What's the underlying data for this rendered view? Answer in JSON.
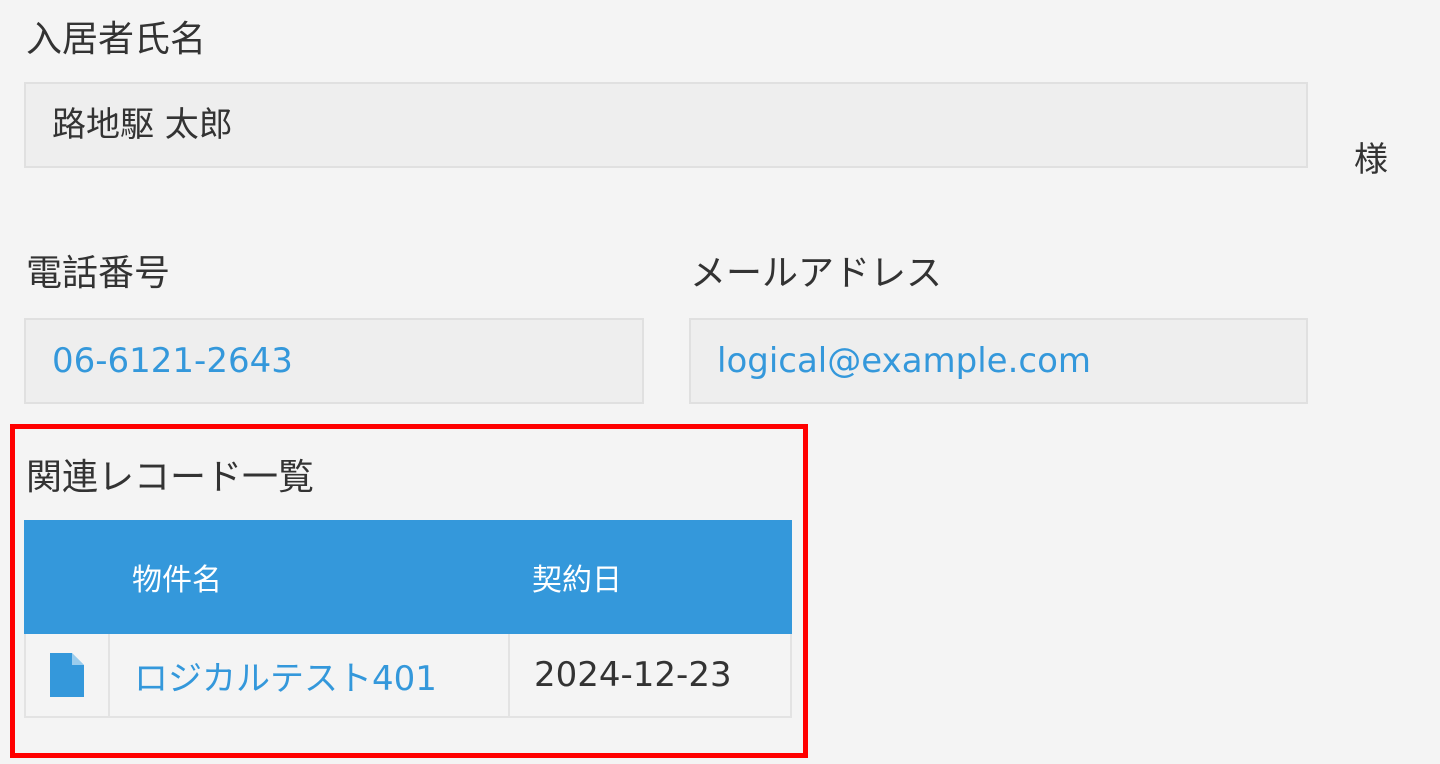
{
  "form": {
    "name": {
      "label": "入居者氏名",
      "value": "路地駆 太郎",
      "suffix": "様"
    },
    "phone": {
      "label": "電話番号",
      "value": "06-6121-2643"
    },
    "email": {
      "label": "メールアドレス",
      "value": "logical@example.com"
    }
  },
  "related_records": {
    "title": "関連レコード一覧",
    "columns": [
      "物件名",
      "契約日"
    ],
    "rows": [
      {
        "property_name": "ロジカルテスト401",
        "contract_date": "2024-12-23"
      }
    ]
  },
  "colors": {
    "accent": "#3498db",
    "highlight_border": "#ff0000",
    "page_bg": "#f4f4f4",
    "field_bg": "#eeeeee"
  }
}
